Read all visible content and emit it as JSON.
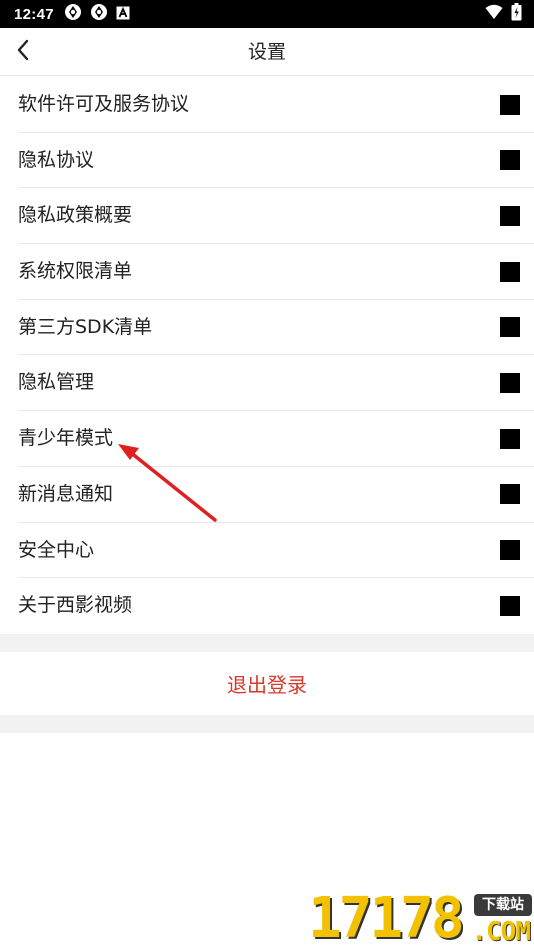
{
  "status_bar": {
    "time": "12:47",
    "left_icons": [
      "sync-icon",
      "sync-icon",
      "app-a-icon"
    ],
    "right_icons": [
      "wifi-icon",
      "battery-charging-icon"
    ]
  },
  "nav": {
    "title": "设置",
    "back_icon": "chevron-left-icon"
  },
  "settings": {
    "items": [
      {
        "label": "软件许可及服务协议"
      },
      {
        "label": "隐私协议"
      },
      {
        "label": "隐私政策概要"
      },
      {
        "label": "系统权限清单"
      },
      {
        "label": "第三方SDK清单"
      },
      {
        "label": "隐私管理"
      },
      {
        "label": "青少年模式"
      },
      {
        "label": "新消息通知"
      },
      {
        "label": "安全中心"
      },
      {
        "label": "关于西影视频"
      }
    ]
  },
  "logout": {
    "label": "退出登录"
  },
  "colors": {
    "logout_text": "#d63a2a",
    "annotation_arrow": "#e02020",
    "watermark": "#f2c200"
  },
  "watermark": {
    "digits": "17178",
    "badge": "下载站",
    "suffix": ".COM"
  }
}
